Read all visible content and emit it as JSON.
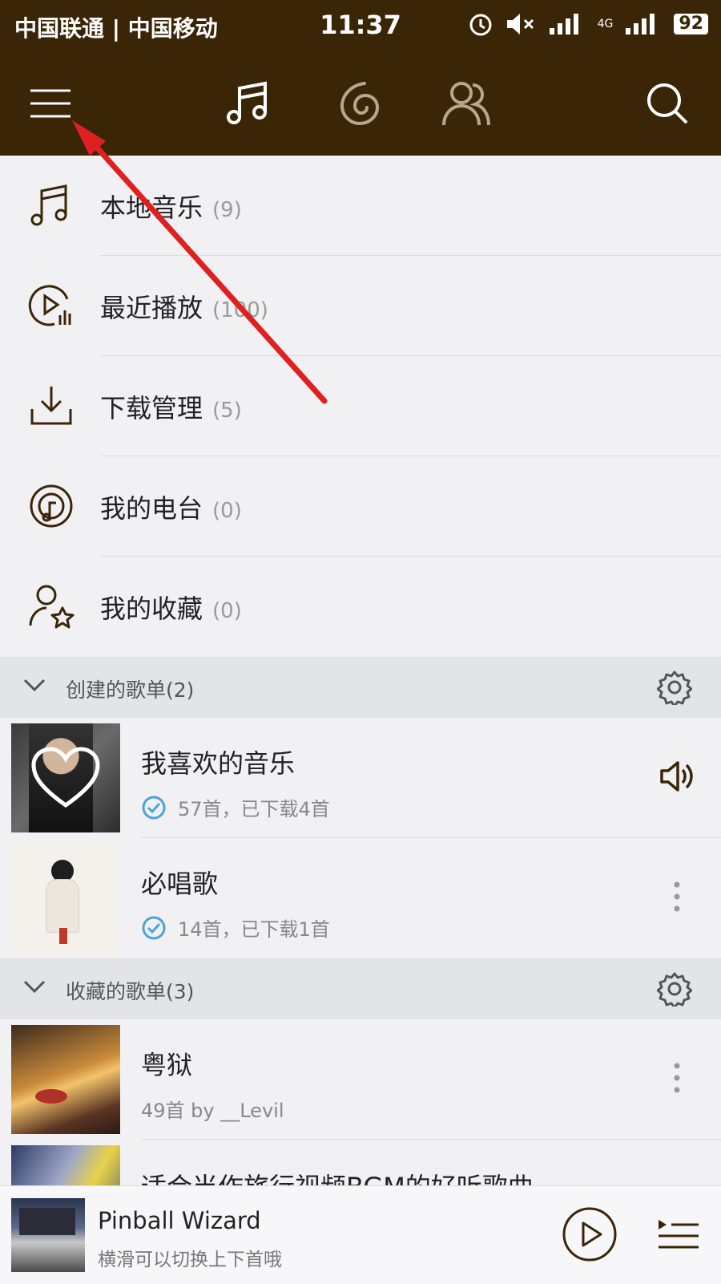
{
  "status": {
    "carrier": "中国联通 | 中国移动",
    "time": "11:37",
    "network": "4G",
    "battery": "92"
  },
  "nav": {
    "menu_icon": "menu-icon",
    "tabs": [
      "music-note-icon",
      "discover-icon",
      "friends-icon"
    ],
    "search_icon": "search-icon"
  },
  "menu": [
    {
      "label": "本地音乐",
      "count": "(9)"
    },
    {
      "label": "最近播放",
      "count": "(100)"
    },
    {
      "label": "下载管理",
      "count": "(5)"
    },
    {
      "label": "我的电台",
      "count": "(0)"
    },
    {
      "label": "我的收藏",
      "count": "(0)"
    }
  ],
  "created_section": {
    "title": "创建的歌单(2)"
  },
  "created": [
    {
      "title": "我喜欢的音乐",
      "sub": "57首，已下载4首"
    },
    {
      "title": "必唱歌",
      "sub": "14首，已下载1首"
    }
  ],
  "collected_section": {
    "title": "收藏的歌单(3)"
  },
  "collected": [
    {
      "title": "粤狱",
      "sub": "49首 by __Levil"
    },
    {
      "title": "适合当作旅行视频BGM的好听歌曲"
    }
  ],
  "player": {
    "title": "Pinball Wizard",
    "subtitle": "横滑可以切换上下首哦"
  },
  "colors": {
    "header": "#3a2507",
    "annotation_arrow": "#e02020",
    "check": "#4aa3df"
  }
}
